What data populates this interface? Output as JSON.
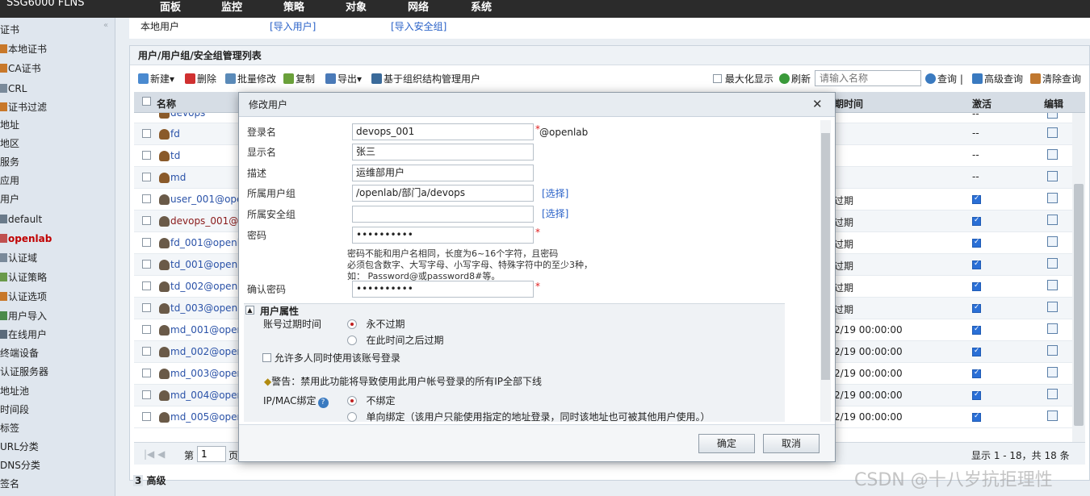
{
  "topbar": {
    "brand": "SSG6000 FLNS",
    "nav": [
      "面板",
      "监控",
      "策略",
      "对象",
      "网络",
      "系统"
    ]
  },
  "sidebar": {
    "items": [
      "证书",
      "本地证书",
      "CA证书",
      "CRL",
      "证书过滤",
      "地址",
      "地区",
      "服务",
      "应用",
      "用户",
      "default",
      "openlab",
      "认证域",
      "认证策略",
      "认证选项",
      "用户导入",
      "在线用户",
      "终端设备",
      "认证服务器",
      "地址池",
      "时间段",
      "标签",
      "URL分类",
      "DNS分类",
      "签名"
    ],
    "active": "openlab"
  },
  "tabs": {
    "local_user": "本地用户",
    "import_user": "[导入用户]",
    "import_group": "[导入安全组]"
  },
  "panel": {
    "title": "用户/用户组/安全组管理列表",
    "toolbar": {
      "new": "新建▾",
      "delete": "删除",
      "batch_edit": "批量修改",
      "copy": "复制",
      "export": "导出▾",
      "org_manage": "基于组织结构管理用户",
      "maximize": "最大化显示",
      "refresh": "刷新",
      "search_placeholder": "请输入名称",
      "query": "查询",
      "advanced_query": "高级查询",
      "clear_query": "清除查询"
    },
    "columns": {
      "name": "名称",
      "expire": "过期时间",
      "active": "激活",
      "edit": "编辑"
    },
    "rows": [
      {
        "name": "devops",
        "expire": "",
        "active": "--"
      },
      {
        "name": "fd",
        "expire": "",
        "active": "--"
      },
      {
        "name": "td",
        "expire": "",
        "active": "--"
      },
      {
        "name": "md",
        "expire": "",
        "active": "--"
      },
      {
        "name": "user_001@oper",
        "expire": "过期",
        "active": ""
      },
      {
        "name": "devops_001@o",
        "expire": "过期",
        "active": ""
      },
      {
        "name": "fd_001@openla",
        "expire": "过期",
        "active": ""
      },
      {
        "name": "td_001@openla",
        "expire": "过期",
        "active": ""
      },
      {
        "name": "td_002@openla",
        "expire": "过期",
        "active": ""
      },
      {
        "name": "td_003@openla",
        "expire": "过期",
        "active": ""
      },
      {
        "name": "md_001@openl",
        "expire": "2/19 00:00:00",
        "active": ""
      },
      {
        "name": "md_002@openl",
        "expire": "2/19 00:00:00",
        "active": ""
      },
      {
        "name": "md_003@openl",
        "expire": "2/19 00:00:00",
        "active": ""
      },
      {
        "name": "md_004@openl",
        "expire": "2/19 00:00:00",
        "active": ""
      },
      {
        "name": "md_005@openl",
        "expire": "2/19 00:00:00",
        "active": ""
      }
    ],
    "pager": {
      "prefix": "第",
      "page": "1",
      "suffix": "页",
      "summary": "显示 1 - 18，共 18 条"
    },
    "advanced": "高级"
  },
  "modal": {
    "title": "修改用户",
    "login_label": "登录名",
    "login_value": "devops_001",
    "login_suffix": "@openlab",
    "display_label": "显示名",
    "display_value": "张三",
    "desc_label": "描述",
    "desc_value": "运维部用户",
    "group_label": "所属用户组",
    "group_value": "/openlab/部门a/devops",
    "select_link": "[选择]",
    "secgroup_label": "所属安全组",
    "secgroup_value": "",
    "password_label": "密码",
    "password_value": "••••••••••",
    "password_hint_1": "密码不能和用户名相同，长度为6~16个字符，且密码",
    "password_hint_2": "必须包含数字、大写字母、小写字母、特殊字符中的至少3种，",
    "password_hint_3": "如： Password@或password8#等。",
    "confirm_label": "确认密码",
    "confirm_value": "••••••••••",
    "attrs_title": "用户属性",
    "expire_label": "账号过期时间",
    "expire_never": "永不过期",
    "expire_after": "在此时间之后过期",
    "multi_login": "允许多人同时使用该账号登录",
    "warning": "警告：禁用此功能将导致使用此用户帐号登录的所有IP全部下线",
    "ipmac_label": "IP/MAC绑定",
    "bind_none": "不绑定",
    "bind_oneway": "单向绑定（该用户只能使用指定的地址登录，同时该地址也可被其他用户使用。）",
    "ok": "确定",
    "cancel": "取消"
  },
  "watermark": "CSDN @十八岁抗拒理性"
}
